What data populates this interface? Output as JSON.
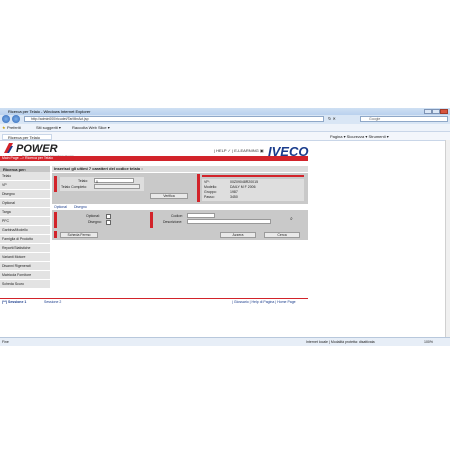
{
  "window": {
    "title": "Ricerca per Telaio - Windows Internet Explorer"
  },
  "address": {
    "url": "http://admin000/ricudet/TarMinAct.jsp",
    "search_placeholder": "Google"
  },
  "favorites": {
    "label": "Preferiti",
    "suggested": "Siti suggeriti ▾",
    "gallery": "Raccolta Web Slice ▾"
  },
  "tab": {
    "label": "Ricerca per Telaio",
    "tools": "Pagina ▾  Sicurezza ▾  Strumenti ▾"
  },
  "header": {
    "logo": "POWER",
    "logo_sub": "Project Over Warranty & Extraordinary Repairs",
    "help": "| HELP ✓ | E-LEARNING ▣",
    "brand": "IVECO"
  },
  "breadcrumb": "Main Page --> Ricerca per Telaio",
  "sidebar": {
    "heading": "Ricerca per:",
    "items": [
      "Telaio",
      "VP",
      "Disegno",
      "Optional",
      "Targa",
      "PFC",
      "Garbina/Modello",
      "Famiglia di Prodotto",
      "Reporti/Statistiche",
      "Varianti Motore",
      "Disanni Rigenerati",
      "Matricola Fornitore",
      "Scheda Scuro"
    ]
  },
  "main": {
    "instruction": "Inserisci gli ultimi 7 caratteri del codice telaio :",
    "telaio_label": "Telaio:",
    "telaio_value": "0",
    "telaio_completo_label": "Telaio Completo:",
    "verify_button": "Verifica",
    "info": [
      {
        "k": "VP:",
        "v": "00Z09048R20015"
      },
      {
        "k": "Modello:",
        "v": "DAILY M F 2006"
      },
      {
        "k": "Gruppo:",
        "v": "1987"
      },
      {
        "k": "Passo:",
        "v": "3450"
      }
    ],
    "tabs": [
      "Optional",
      "Disegno"
    ],
    "optional_label": "Optional:",
    "disegno_label": "Disegno:",
    "codice_label": "Codice:",
    "descrizione_label": "Descrizione:",
    "scheda_button": "Scheda Fermo",
    "azzera_button": "Azzera",
    "cerca_button": "Cerca"
  },
  "bottom": {
    "tab1": "(**) Sessione 1",
    "tab2": "Sessione 2",
    "links": "| Glossario | Help di Pagina | Home Page"
  },
  "status": {
    "left": "Fine",
    "zone": "Internet locale | Modalità protetta: disattivata",
    "zoom": "100%"
  },
  "colors": {
    "accent_red": "#d2232a",
    "brand_blue": "#1a3c8c"
  }
}
